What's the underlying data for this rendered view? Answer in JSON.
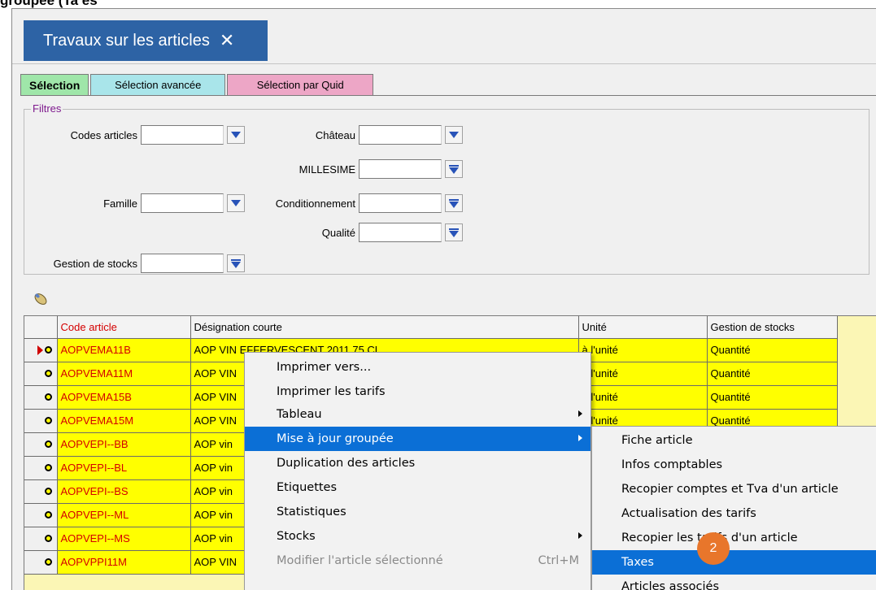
{
  "top_fragment": "groupée (Ta es",
  "doc_tab": {
    "title": "Travaux sur les articles",
    "close": "✕"
  },
  "selection_tabs": [
    "Sélection",
    "Sélection avancée",
    "Sélection par Quid"
  ],
  "filters": {
    "legend": "Filtres",
    "fields": {
      "codes_articles": "Codes articles",
      "chateau": "Château",
      "millesime": "MILLESIME",
      "famille": "Famille",
      "conditionnement": "Conditionnement",
      "qualite": "Qualité",
      "gestion_stocks": "Gestion de stocks"
    }
  },
  "grid": {
    "columns": [
      "Code article",
      "Désignation courte",
      "Unité",
      "Gestion de stocks"
    ],
    "rows": [
      {
        "code": "AOPVEMA11B",
        "designation": "AOP VIN EFFERVESCENT 2011 75 CL",
        "unite": "à l'unité",
        "gestion": "Quantité"
      },
      {
        "code": "AOPVEMA11M",
        "designation": "AOP VIN",
        "unite": "à l'unité",
        "gestion": "Quantité"
      },
      {
        "code": "AOPVEMA15B",
        "designation": "AOP VIN",
        "unite": "à l'unité",
        "gestion": "Quantité"
      },
      {
        "code": "AOPVEMA15M",
        "designation": "AOP VIN",
        "unite": "à l'unité",
        "gestion": "Quantité"
      },
      {
        "code": "AOPVEPI--BB",
        "designation": "AOP vin",
        "unite": "",
        "gestion": ""
      },
      {
        "code": "AOPVEPI--BL",
        "designation": "AOP vin",
        "unite": "",
        "gestion": ""
      },
      {
        "code": "AOPVEPI--BS",
        "designation": "AOP vin",
        "unite": "",
        "gestion": ""
      },
      {
        "code": "AOPVEPI--ML",
        "designation": "AOP vin",
        "unite": "",
        "gestion": ""
      },
      {
        "code": "AOPVEPI--MS",
        "designation": "AOP vin",
        "unite": "",
        "gestion": ""
      },
      {
        "code": "AOPVPPI11M",
        "designation": "AOP VIN",
        "unite": "",
        "gestion": ""
      }
    ]
  },
  "context_menu": {
    "items": [
      "Imprimer vers...",
      "Imprimer les tarifs",
      "Tableau",
      "Mise à jour groupée",
      "Duplication des articles",
      "Etiquettes",
      "Statistiques",
      "Stocks",
      "Modifier l'article sélectionné"
    ],
    "shortcut": "Ctrl+M"
  },
  "submenu": {
    "items": [
      "Fiche article",
      "Infos comptables",
      "Recopier comptes et Tva d'un article",
      "Actualisation des tarifs",
      "Recopier les tarifs d'un article",
      "Taxes",
      "Articles associés"
    ]
  },
  "step_badge": "2",
  "colors": {
    "tab_blue": "#2d63a5",
    "highlight": "#0b6fd6",
    "row_yellow": "#ffff00",
    "code_red": "#d40000",
    "badge_orange": "#e8762b"
  }
}
